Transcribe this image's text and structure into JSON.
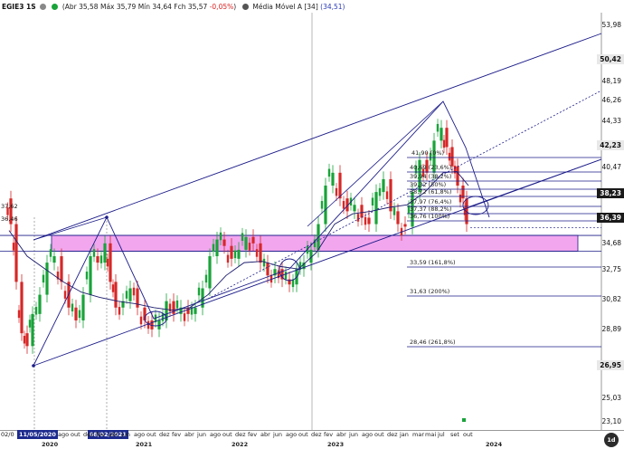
{
  "header": {
    "symbol": "EGIE3 1S",
    "ohlc_text": "(Abr 35,58 Máx 35,79 Mín 34,64 Fch 35,57",
    "change": "-0,05%",
    "close_paren": ")",
    "ma_label": "Média Móvel A [34]",
    "ma_value": "(34,51)"
  },
  "y_axis": {
    "labels": [
      "53,98",
      "50,42",
      "48,19",
      "46,26",
      "44,33",
      "40,47",
      "38,23",
      "36,39",
      "34,68",
      "32,75",
      "30,82",
      "28,89",
      "26,95",
      "25,03",
      "23,10"
    ],
    "badges": {
      "top_price": "50,42",
      "price_a": "42,23",
      "price_b": "38,23",
      "price_c": "36,39",
      "low_price": "26,95"
    }
  },
  "left_labels": {
    "a": "37,62",
    "b": "36,46",
    "c": "02/0"
  },
  "fib_levels": [
    "41,90 (0%)",
    "40,69 (23,6%)",
    "39,94 (38,2%)",
    "39,32 (50%)",
    "38,72 (61,8%)",
    "37,97 (76,4%)",
    "37,37 (88,2%)",
    "36,76 (100%)",
    "33,59 (161,8%)",
    "31,63 (200%)",
    "28,46 (261,8%)"
  ],
  "x_axis": {
    "months": [
      "ago",
      "out",
      "dez",
      "fev",
      "abr",
      "jun",
      "ago",
      "out",
      "dez",
      "fev",
      "abr",
      "jun",
      "ago",
      "out",
      "dez",
      "fev",
      "abr",
      "jun",
      "ago",
      "out",
      "dez",
      "fev",
      "abr",
      "jun",
      "ago",
      "out",
      "dez",
      "jan",
      "mar",
      "mai",
      "jul",
      "set",
      "out"
    ],
    "years": [
      "2020",
      "2021",
      "2022",
      "2023",
      "2024"
    ],
    "date_badges": [
      "11/05/2020",
      "08/02/2021"
    ],
    "timeframe": "1d"
  },
  "colors": {
    "up": "#19a33a",
    "down": "#d62828",
    "lines": "#1c1c8a",
    "ma": "#1c1c6e",
    "zone": "#f2a6ee"
  }
}
